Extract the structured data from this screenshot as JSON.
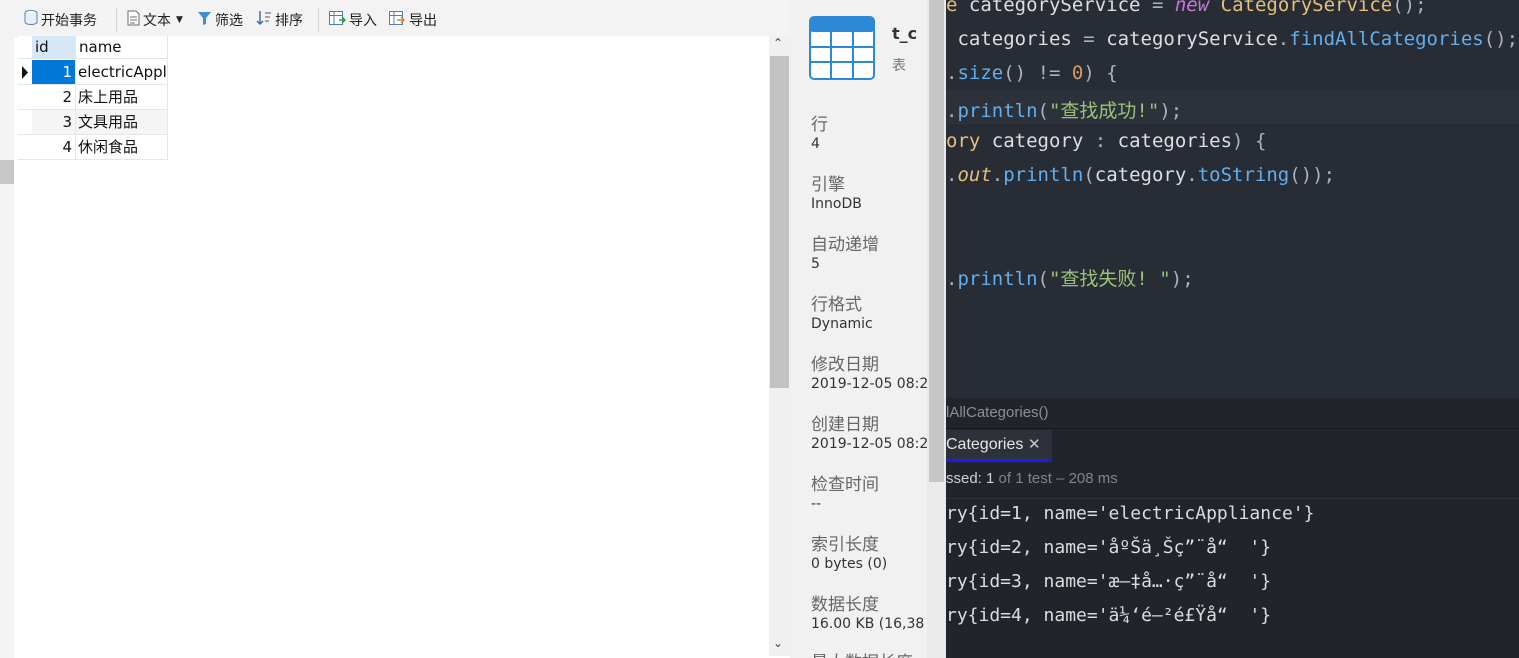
{
  "toolbar": {
    "begin_transaction": "开始事务",
    "text": "文本",
    "filter": "筛选",
    "sort": "排序",
    "import": "导入",
    "export": "导出"
  },
  "grid": {
    "columns": [
      "id",
      "name"
    ],
    "rows": [
      {
        "id": "1",
        "name": "electricAppl"
      },
      {
        "id": "2",
        "name": "床上用品"
      },
      {
        "id": "3",
        "name": "文具用品"
      },
      {
        "id": "4",
        "name": "休闲食品"
      }
    ]
  },
  "object_info": {
    "name": "t_c",
    "type": "表",
    "fields": [
      {
        "label": "行",
        "value": "4"
      },
      {
        "label": "引擎",
        "value": "InnoDB"
      },
      {
        "label": "自动递增",
        "value": "5"
      },
      {
        "label": "行格式",
        "value": "Dynamic"
      },
      {
        "label": "修改日期",
        "value": "2019-12-05 08:2"
      },
      {
        "label": "创建日期",
        "value": "2019-12-05 08:2"
      },
      {
        "label": "检查时间",
        "value": "--"
      },
      {
        "label": "索引长度",
        "value": "0 bytes (0)"
      },
      {
        "label": "数据长度",
        "value": "16.00 KB (16,38"
      },
      {
        "label": "最大数据长度",
        "value": ""
      }
    ]
  },
  "editor": {
    "lines": [
      "e categoryService = new CategoryService();",
      " categories = categoryService.findAllCategories();",
      ".size() != 0) {",
      ".println(\"查找成功!\");",
      "ory category : categories) {",
      ".out.println(category.toString());",
      "",
      "",
      ".println(\"查找失败! \");"
    ]
  },
  "test_panel": {
    "method": "lAllCategories()",
    "tab": "Categories",
    "status_prefix": "ssed: 1",
    "status_suffix": " of 1 test – 208 ms",
    "output": [
      "ry{id=1, name='electricAppliance'}",
      "ry{id=2, name='åºŠä¸Šç”¨å“  '}",
      "ry{id=3, name='æ–‡å…·ç”¨å“  '}",
      "ry{id=4, name='ä¼‘é—²é£Ÿå“  '}"
    ]
  },
  "colors": {
    "keyword": "#c678dd",
    "method": "#61afef",
    "string": "#98c379",
    "number": "#d19a66",
    "variable": "#e5c07b",
    "selection": "#0078d7",
    "tab_underline": "#1a1aff"
  }
}
